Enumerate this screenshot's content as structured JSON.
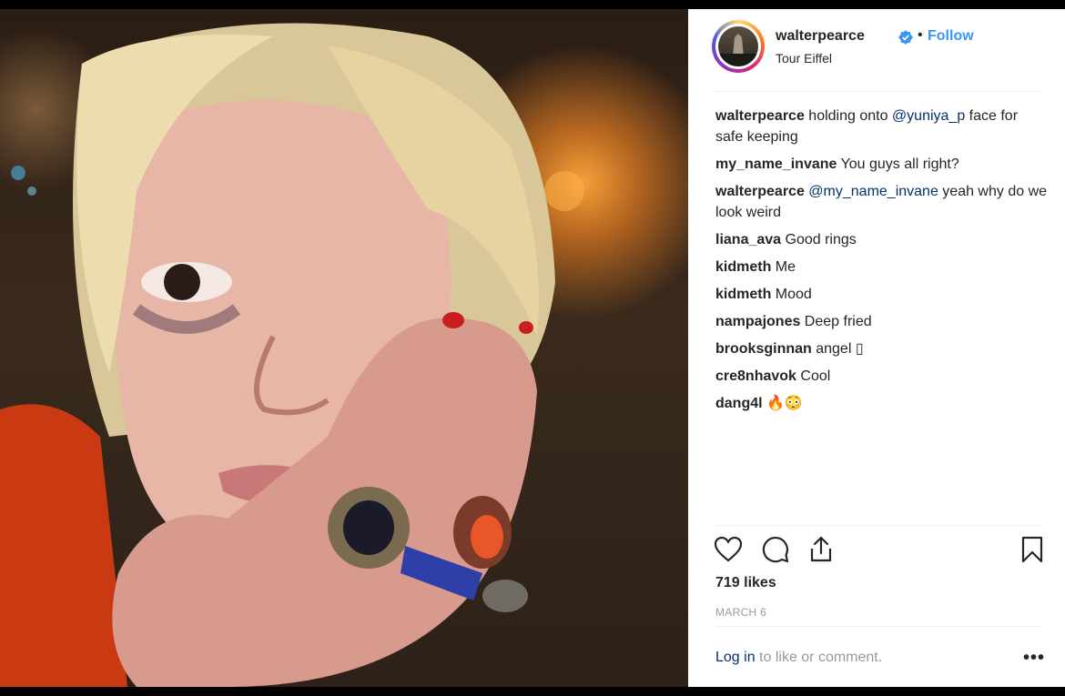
{
  "post": {
    "username": "walterpearce",
    "dot": "•",
    "follow_label": "Follow",
    "location": "Tour Eiffel",
    "likes": "719 likes",
    "date": "MARCH 6",
    "login_link": "Log in",
    "login_rest": " to like or comment.",
    "more_label": "•••"
  },
  "comments": [
    {
      "user": "walterpearce",
      "parts": [
        {
          "t": " holding onto "
        },
        {
          "m": "@yuniya_p"
        },
        {
          "t": " face for safe keeping"
        }
      ]
    },
    {
      "user": "my_name_invane",
      "parts": [
        {
          "t": " You guys all right?"
        }
      ]
    },
    {
      "user": "walterpearce",
      "parts": [
        {
          "t": " "
        },
        {
          "m": "@my_name_invane"
        },
        {
          "t": " yeah why do we look weird"
        }
      ]
    },
    {
      "user": "liana_ava",
      "parts": [
        {
          "t": " Good rings"
        }
      ]
    },
    {
      "user": "kidmeth",
      "parts": [
        {
          "t": " Me"
        }
      ]
    },
    {
      "user": "kidmeth",
      "parts": [
        {
          "t": " Mood"
        }
      ]
    },
    {
      "user": "nampajones",
      "parts": [
        {
          "t": " Deep fried"
        }
      ]
    },
    {
      "user": "brooksginnan",
      "parts": [
        {
          "t": " angel ▯"
        }
      ]
    },
    {
      "user": "cre8nhavok",
      "parts": [
        {
          "t": " Cool"
        }
      ]
    },
    {
      "user": "dang4l",
      "parts": [
        {
          "t": " 🔥😳"
        }
      ]
    }
  ],
  "icons": {
    "like": "heart-icon",
    "comment": "comment-icon",
    "share": "share-icon",
    "save": "bookmark-icon",
    "verified": "verified-badge-icon"
  },
  "colors": {
    "accent": "#3897f0",
    "mention": "#003569",
    "text": "#262626",
    "muted": "#999999"
  }
}
